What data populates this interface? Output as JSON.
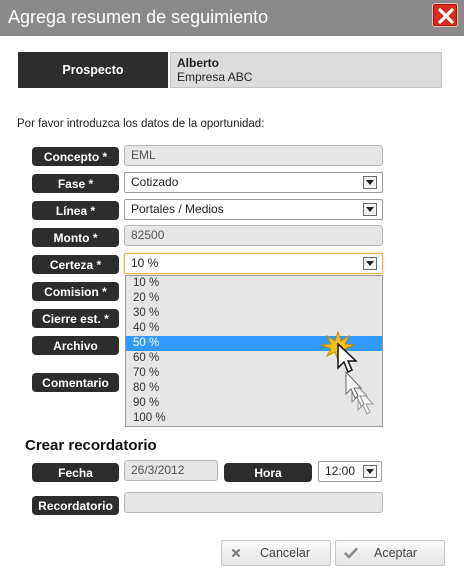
{
  "dialog": {
    "title": "Agrega resumen de seguimiento"
  },
  "prospect": {
    "label": "Prospecto",
    "name": "Alberto",
    "company": "Empresa ABC"
  },
  "intro_text": "Por favor introduzca los datos de la oportunidad:",
  "form": {
    "concepto": {
      "label": "Concepto *",
      "value": "EML"
    },
    "fase": {
      "label": "Fase *",
      "value": "Cotizado"
    },
    "linea": {
      "label": "Línea *",
      "value": "Portales / Medios"
    },
    "monto": {
      "label": "Monto *",
      "value": "82500"
    },
    "certeza": {
      "label": "Certeza *",
      "value": "10 %",
      "options": [
        "10 %",
        "20 %",
        "30 %",
        "40 %",
        "50 %",
        "60 %",
        "70 %",
        "80 %",
        "90 %",
        "100 %"
      ],
      "highlighted": "50 %"
    },
    "comision": {
      "label": "Comision *"
    },
    "cierre": {
      "label": "Cierre est. *"
    },
    "archivo": {
      "label": "Archivo"
    },
    "comentario": {
      "label": "Comentario"
    }
  },
  "reminder": {
    "section_title": "Crear recordatorio",
    "fecha_label": "Fecha",
    "fecha_value": "26/3/2012",
    "hora_label": "Hora",
    "hora_value": "12:00",
    "recordatorio_label": "Recordatorio",
    "recordatorio_value": ""
  },
  "actions": {
    "cancel": "Cancelar",
    "accept": "Aceptar"
  },
  "colors": {
    "titlebar": "#8a8a8a",
    "label_bg": "#2d2d2d",
    "selection": "#3399ff",
    "close": "#d92b1f"
  }
}
